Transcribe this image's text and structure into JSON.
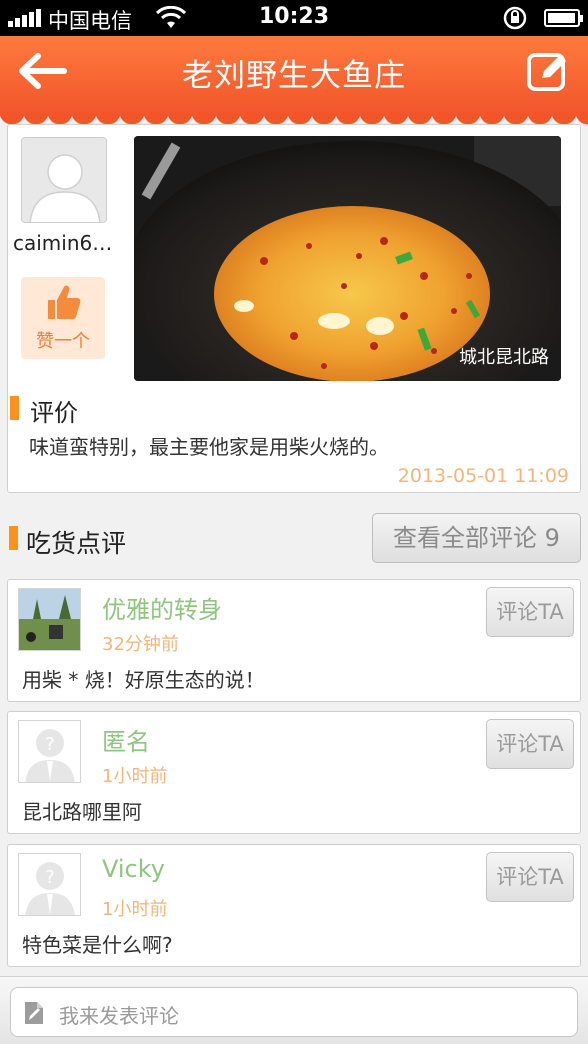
{
  "status_bar": {
    "carrier": "中国电信",
    "time": "10:23",
    "icons": [
      "signal-icon",
      "wifi-icon",
      "rotation-lock-icon",
      "battery-icon"
    ]
  },
  "nav": {
    "title": "老刘野生大鱼庄",
    "back_icon": "back-arrow-icon",
    "compose_icon": "compose-icon",
    "color_top": "#ff7a3e",
    "color_bottom": "#f1552a"
  },
  "post": {
    "username": "caimin6…",
    "like_label": "赞一个",
    "photo_caption": "城北昆北路",
    "review_title": "评价",
    "review_text": "味道蛮特别，最主要他家是用柴火烧的。",
    "time": "2013-05-01 11:09"
  },
  "comments_section": {
    "title": "吃货点评",
    "view_all_label": "查看全部评论 9",
    "accent": "#f7931e"
  },
  "comments": [
    {
      "name": "优雅的转身",
      "time": "32分钟前",
      "text": "用柴 * 烧！好原生态的说！",
      "reply_label": "评论TA",
      "avatar": "photo-avatar"
    },
    {
      "name": "匿名",
      "time": "1小时前",
      "text": "昆北路哪里阿",
      "reply_label": "评论TA",
      "avatar": "default-avatar-icon"
    },
    {
      "name": "Vicky",
      "time": "1小时前",
      "text": "特色菜是什么啊?",
      "reply_label": "评论TA",
      "avatar": "default-avatar-icon"
    }
  ],
  "input": {
    "placeholder": "我来发表评论",
    "icon": "pencil-note-icon"
  }
}
